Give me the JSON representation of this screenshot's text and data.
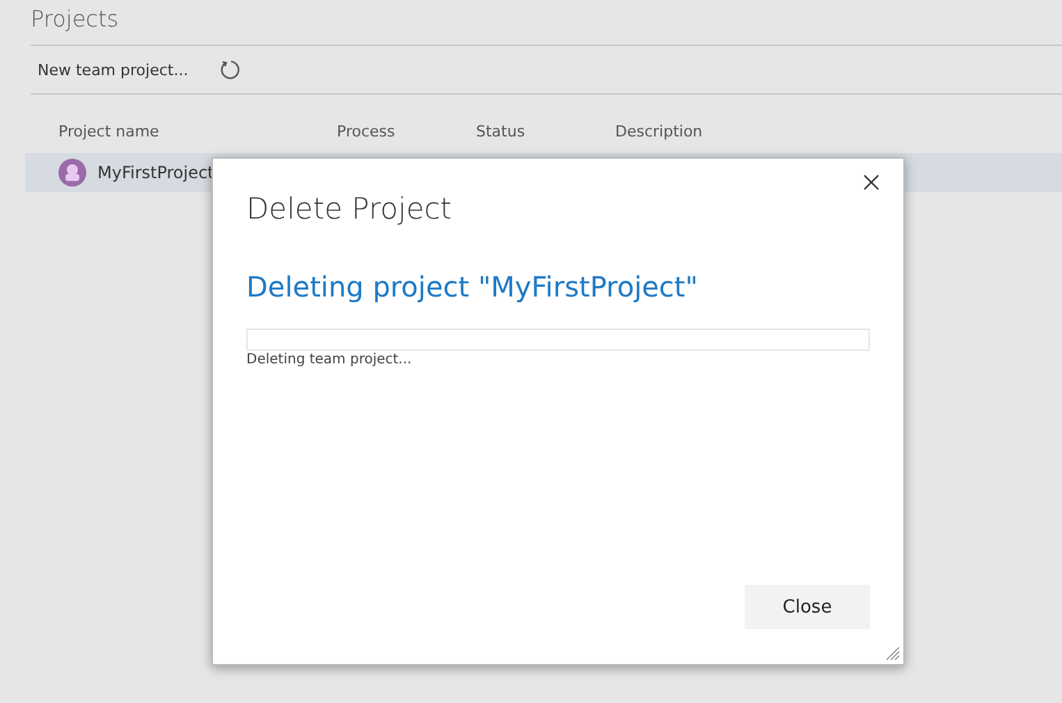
{
  "page": {
    "title": "Projects"
  },
  "toolbar": {
    "new_project": "New team project..."
  },
  "table": {
    "columns": [
      "Project name",
      "Process",
      "Status",
      "Description"
    ],
    "rows": [
      {
        "name": "MyFirstProject",
        "selected": true
      }
    ]
  },
  "dialog": {
    "title": "Delete Project",
    "heading": "Deleting project \"MyFirstProject\"",
    "progress": {
      "level": 0
    },
    "status": "Deleting team project...",
    "close_button": "Close"
  }
}
